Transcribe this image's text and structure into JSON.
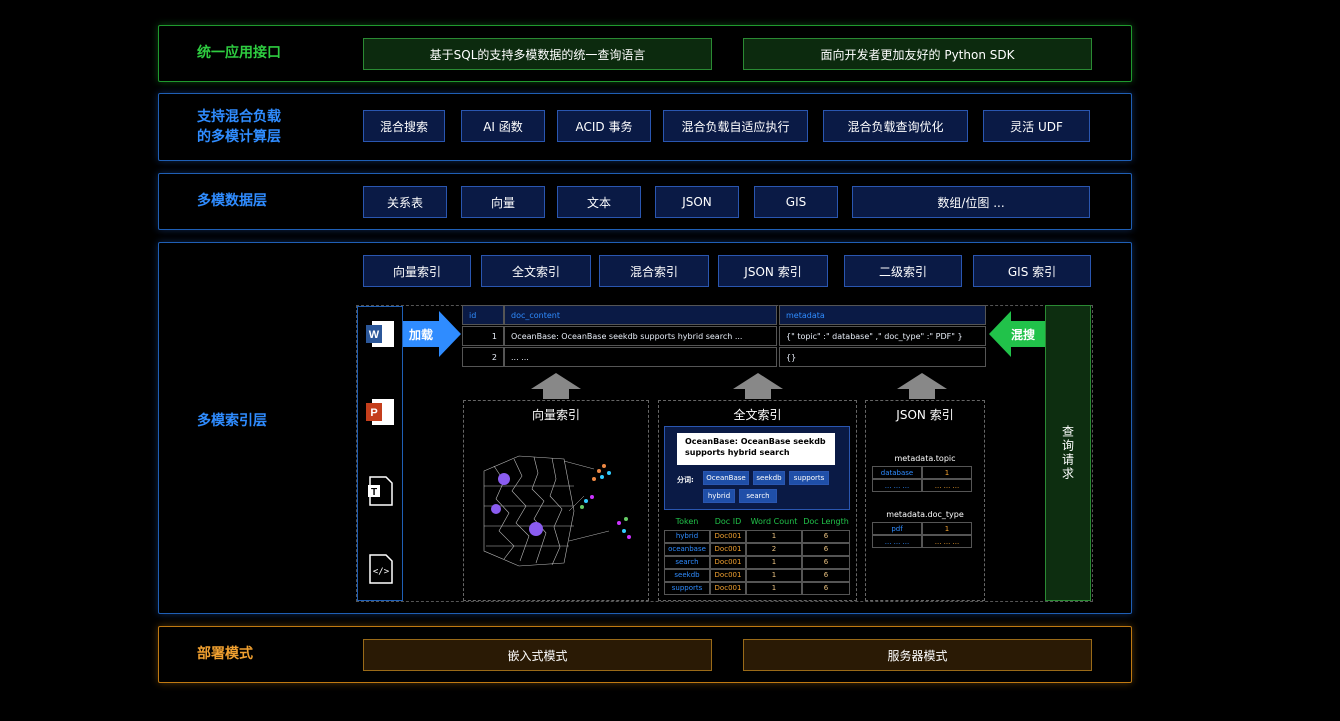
{
  "layers": {
    "api": {
      "title": "统一应用接口",
      "items": [
        "基于SQL的支持多模数据的统一查询语言",
        "面向开发者更加友好的 Python SDK"
      ]
    },
    "compute": {
      "title_line1": "支持混合负载",
      "title_line2": "的多模计算层",
      "items": [
        "混合搜索",
        "AI 函数",
        "ACID 事务",
        "混合负载自适应执行",
        "混合负载查询优化",
        "灵活 UDF"
      ]
    },
    "data": {
      "title": "多模数据层",
      "items": [
        "关系表",
        "向量",
        "文本",
        "JSON",
        "GIS",
        "数组/位图 ..."
      ]
    },
    "index": {
      "title": "多模索引层",
      "items": [
        "向量索引",
        "全文索引",
        "混合索引",
        "JSON 索引",
        "二级索引",
        "GIS 索引"
      ]
    },
    "deploy": {
      "title": "部署模式",
      "items": [
        "嵌入式模式",
        "服务器模式"
      ]
    }
  },
  "detail": {
    "load_label": "加载",
    "hybrid_label": "混搜",
    "query_label": "查询请求",
    "table": {
      "headers": [
        "id",
        "doc_content",
        "metadata"
      ],
      "rows": [
        [
          "1",
          "OceanBase: OceanBase seekdb supports hybrid search ...",
          "{\" topic\" :\" database\" ,\" doc_type\" :\" PDF\" }"
        ],
        [
          "2",
          "... ...",
          "{}"
        ]
      ]
    },
    "vector_panel": {
      "title": "向量索引"
    },
    "fulltext_panel": {
      "title": "全文索引",
      "doc_text": "OceanBase: OceanBase seekdb supports hybrid search",
      "tokenize_label": "分词:",
      "tokens": [
        "OceanBase",
        "seekdb",
        "supports",
        "hybrid",
        "search"
      ],
      "headers": [
        "Token",
        "Doc ID",
        "Word Count",
        "Doc Length"
      ],
      "rows": [
        [
          "hybrid",
          "Doc001",
          "1",
          "6"
        ],
        [
          "oceanbase",
          "Doc001",
          "2",
          "6"
        ],
        [
          "search",
          "Doc001",
          "1",
          "6"
        ],
        [
          "seekdb",
          "Doc001",
          "1",
          "6"
        ],
        [
          "supports",
          "Doc001",
          "1",
          "6"
        ]
      ]
    },
    "json_panel": {
      "title": "JSON 索引",
      "topic_label": "metadata.topic",
      "topic_rows": [
        [
          "database",
          "1"
        ],
        [
          "... ... ...",
          "... ... ..."
        ]
      ],
      "doctype_label": "metadata.doc_type",
      "doctype_rows": [
        [
          "pdf",
          "1"
        ],
        [
          "... ... ...",
          "... ... ..."
        ]
      ]
    }
  },
  "colors": {
    "green": "#1f9a2e",
    "blue": "#1f5fb5",
    "orange": "#c07a12",
    "accent_blue": "#2f8cff",
    "accent_green": "#21c24a"
  }
}
